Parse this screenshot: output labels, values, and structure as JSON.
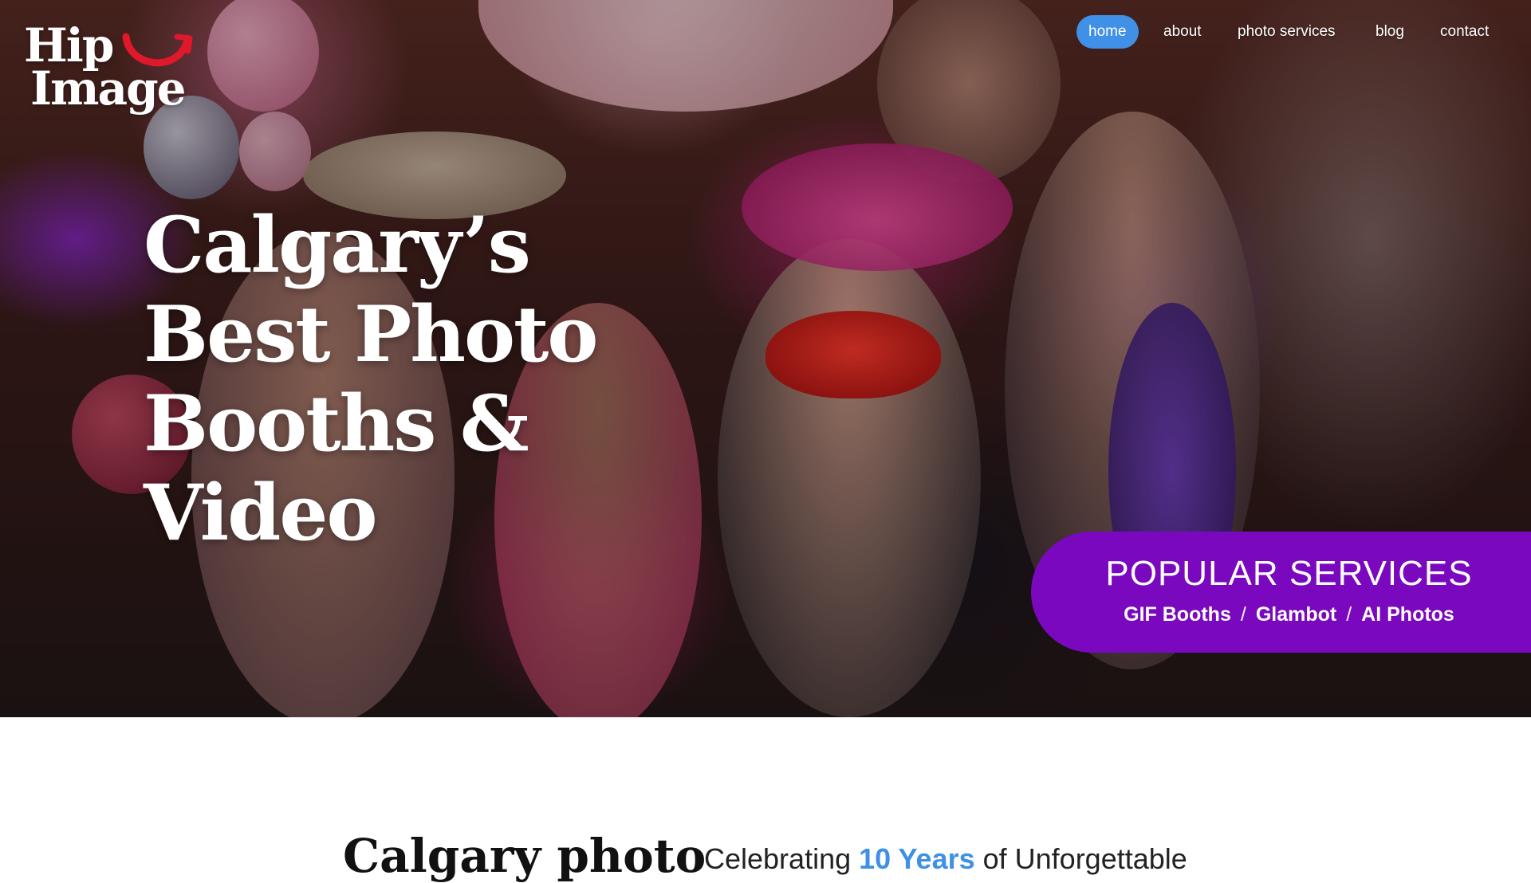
{
  "logo": {
    "line1": "Hip",
    "line2": "Image"
  },
  "nav": {
    "items": [
      {
        "label": "home",
        "active": true
      },
      {
        "label": "about",
        "active": false
      },
      {
        "label": "photo services",
        "active": false
      },
      {
        "label": "blog",
        "active": false
      },
      {
        "label": "contact",
        "active": false
      }
    ]
  },
  "hero": {
    "headline_lines": [
      "Calgary’s",
      "Best Photo",
      "Booths &",
      "Video"
    ]
  },
  "services": {
    "title": "POPULAR SERVICES",
    "links": [
      "GIF Booths",
      "Glambot",
      "AI Photos"
    ],
    "separator": "/"
  },
  "intro": {
    "heading": "Calgary photo",
    "sub_before": "Celebrating ",
    "sub_highlight": "10 Years",
    "sub_after": " of Unforgettable"
  },
  "colors": {
    "nav_active": "#3f90e6",
    "services_bg": "#7a08be",
    "highlight": "#3f90e6"
  },
  "icons": {
    "logo_mark": "smile-arc-icon"
  }
}
